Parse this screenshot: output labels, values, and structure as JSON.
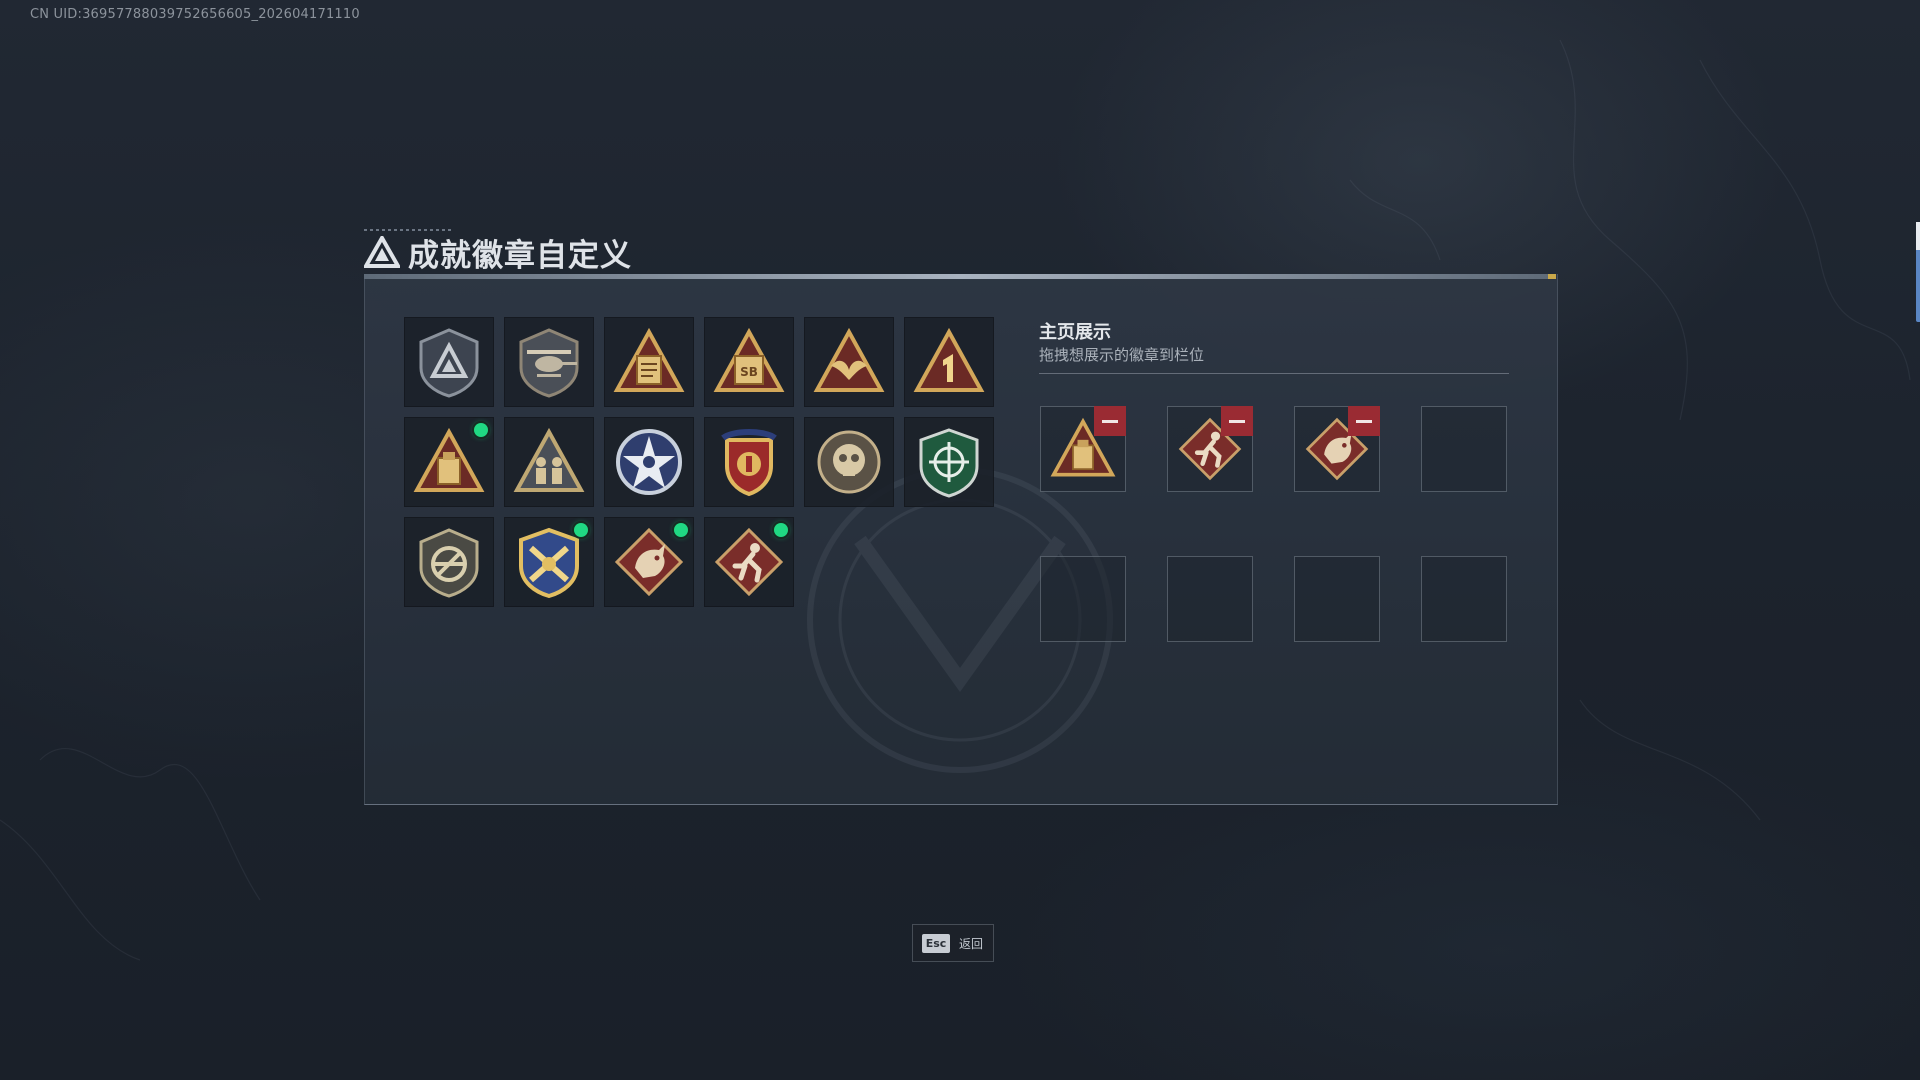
{
  "uid_text": "CN UID:3695778803975265660​5_202604171110",
  "header": {
    "title": "成就徽章自定义",
    "icon": "triangle-logo-icon"
  },
  "badges": [
    {
      "name": "shield-triangle-badge",
      "new": false
    },
    {
      "name": "helicopter-badge",
      "new": false
    },
    {
      "name": "document-triangle-badge",
      "new": false
    },
    {
      "name": "sb-triangle-badge",
      "new": false
    },
    {
      "name": "bird-triangle-badge",
      "new": false
    },
    {
      "name": "number-one-triangle-badge",
      "new": false
    },
    {
      "name": "crate-triangle-badge",
      "new": true
    },
    {
      "name": "soldiers-triangle-badge",
      "new": false
    },
    {
      "name": "star-medal-badge",
      "new": false
    },
    {
      "name": "eagle-crest-badge",
      "new": false
    },
    {
      "name": "skull-emblem-badge",
      "new": false
    },
    {
      "name": "green-crosshair-shield-badge",
      "new": false
    },
    {
      "name": "no-rifle-shield-badge",
      "new": false
    },
    {
      "name": "gold-crossed-arms-badge",
      "new": true
    },
    {
      "name": "dragon-diamond-badge",
      "new": true
    },
    {
      "name": "runner-diamond-badge",
      "new": true
    }
  ],
  "showcase": {
    "title": "主页展示",
    "subtitle": "拖拽想展示的徽章到栏位",
    "slots": [
      {
        "badge": "crate-triangle-badge"
      },
      {
        "badge": "runner-diamond-badge"
      },
      {
        "badge": "dragon-diamond-badge"
      },
      {
        "badge": null
      },
      {
        "badge": null
      },
      {
        "badge": null
      },
      {
        "badge": null
      },
      {
        "badge": null
      }
    ]
  },
  "footer": {
    "esc_key": "Esc",
    "esc_label": "返回"
  },
  "colors": {
    "accent_gold": "#c9a84a",
    "new_dot": "#20d983",
    "remove": "#9a2b33",
    "panel": "#2c3542"
  }
}
